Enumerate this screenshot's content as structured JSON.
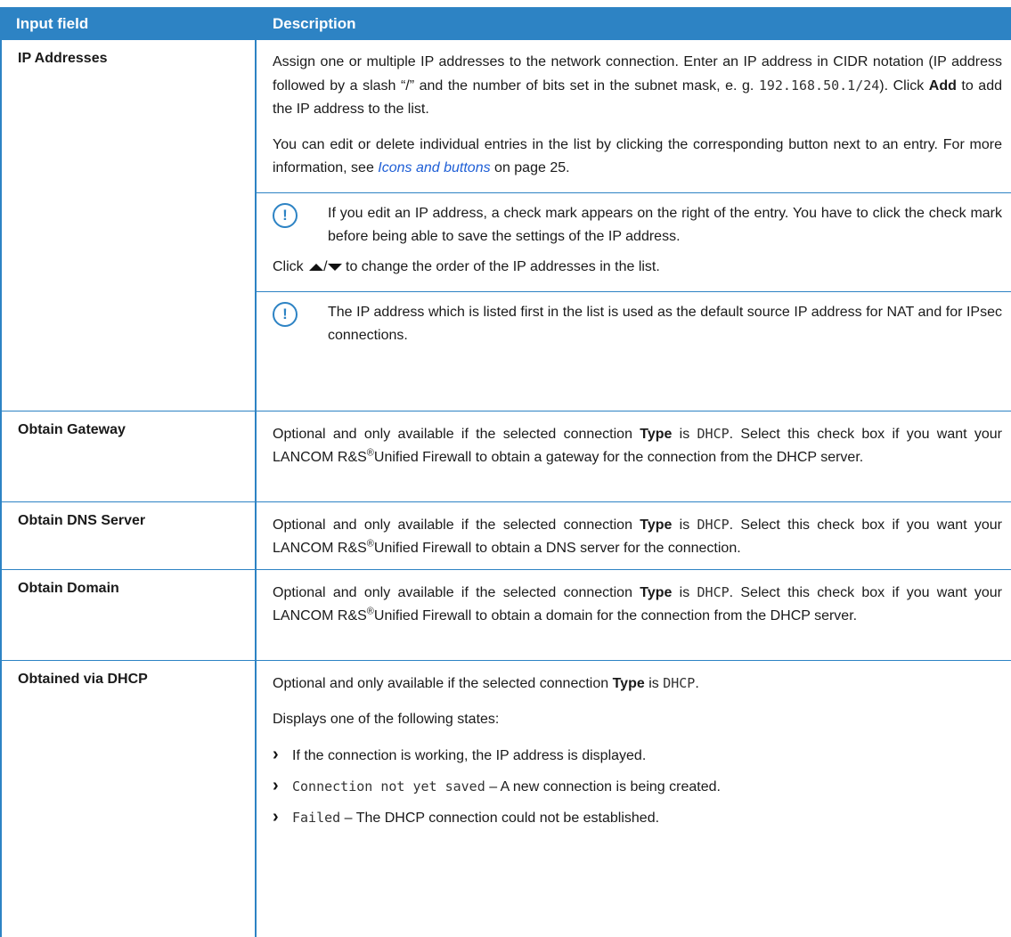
{
  "header": {
    "col1": "Input field",
    "col2": "Description"
  },
  "rows": [
    {
      "field": "IP Addresses",
      "p1a": "Assign one or multiple IP addresses to the network connection. Enter an IP address in CIDR notation (IP address followed by a slash “/” and the number of bits set in the subnet mask, e. g. ",
      "p1code": "192.168.50.1/24",
      "p1b": "). Click ",
      "p1bold": "Add",
      "p1c": " to add the IP address to the list.",
      "p2a": "You can edit or delete individual entries in the list by clicking the corresponding button next to an entry. For more information, see ",
      "p2link": "Icons and buttons",
      "p2b": " on page 25.",
      "note1": "If you edit an IP address, a check mark appears on the right of the entry. You have to click the check mark before being able to save the settings of the IP address.",
      "p3a": "Click ",
      "p3slash": "/",
      "p3b": " to change the order of the IP addresses in the list.",
      "note2": "The IP address which is listed first in the list is used as the default source IP address for NAT and for IPsec connections."
    },
    {
      "field": "Obtain Gateway",
      "a": "Optional and only available if the selected connection ",
      "bold": "Type",
      "b": " is ",
      "code": "DHCP",
      "c": ". Select this check box if you want your LANCOM R&S",
      "sup": "®",
      "d": "Unified Firewall to obtain a gateway for the connection from the DHCP server."
    },
    {
      "field": "Obtain DNS Server",
      "a": "Optional and only available if the selected connection ",
      "bold": "Type",
      "b": " is ",
      "code": "DHCP",
      "c": ". Select this check box if you want your LANCOM R&S",
      "sup": "®",
      "d": "Unified Firewall to obtain a DNS server for the connection."
    },
    {
      "field": "Obtain Domain",
      "a": "Optional and only available if the selected connection ",
      "bold": "Type",
      "b": " is ",
      "code": "DHCP",
      "c": ". Select this check box if you want your LANCOM R&S",
      "sup": "®",
      "d": "Unified Firewall to obtain a domain for the connection from the DHCP server."
    },
    {
      "field": "Obtained via DHCP",
      "a": "Optional and only available if the selected connection ",
      "bold": "Type",
      "b": " is ",
      "code": "DHCP",
      "c": ".",
      "intro": "Displays one of the following states:",
      "states": [
        {
          "code": "",
          "text": "If the connection is working, the IP address is displayed."
        },
        {
          "code": "Connection not yet saved",
          "text": " – A new connection is being created."
        },
        {
          "code": "Failed",
          "text": " – The DHCP connection could not be established."
        }
      ]
    }
  ],
  "icons": {
    "note": "!",
    "bullet": "›"
  }
}
